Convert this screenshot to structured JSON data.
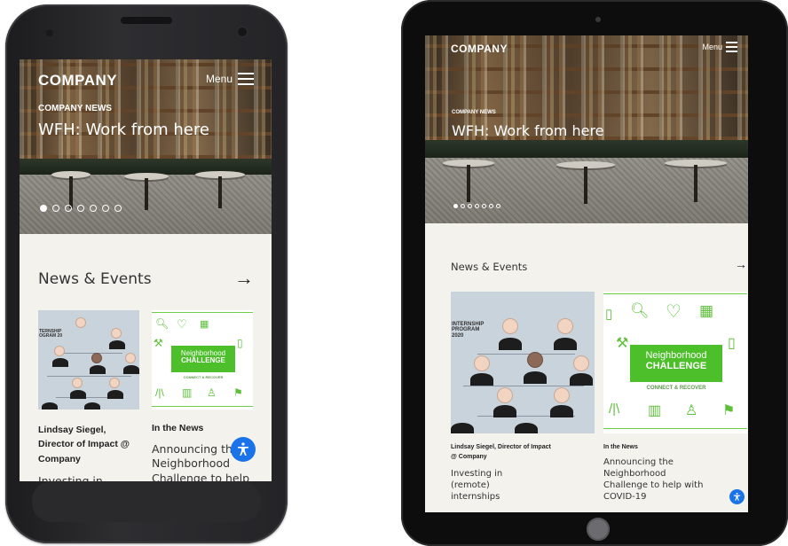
{
  "hero": {
    "brand": "COMPANY",
    "menu_label": "Menu",
    "kicker": "COMPANY NEWS",
    "headline": "WFH: Work from here",
    "carousel_slides": 7,
    "active_slide": 1
  },
  "news": {
    "title": "News & Events",
    "arrow": "→",
    "cards": [
      {
        "caption": "Lindsay Siegel, Director of Impact @ Company",
        "title": "Investing in (remote) internships",
        "title_phone": "Investing in",
        "image_label": "INTERNSHIP PROGRAM 2020",
        "image_label_phone": "TERNSHIP OGRAM 20"
      },
      {
        "kicker": "In the News",
        "title": "Announcing the Neighborhood Challenge to help with COVID-19",
        "title_phone": "Announcing the Neighborhood Challenge to help",
        "image_heading_1": "Neighborhood",
        "image_heading_2": "CHALLENGE",
        "image_sub": "CONNECT & RECOVER"
      }
    ]
  },
  "accessibility": {
    "icon": "accessibility-icon",
    "color": "#1a73e8"
  },
  "colors": {
    "page_bg": "#f4f2ed",
    "challenge_green": "#4cbf2a"
  }
}
